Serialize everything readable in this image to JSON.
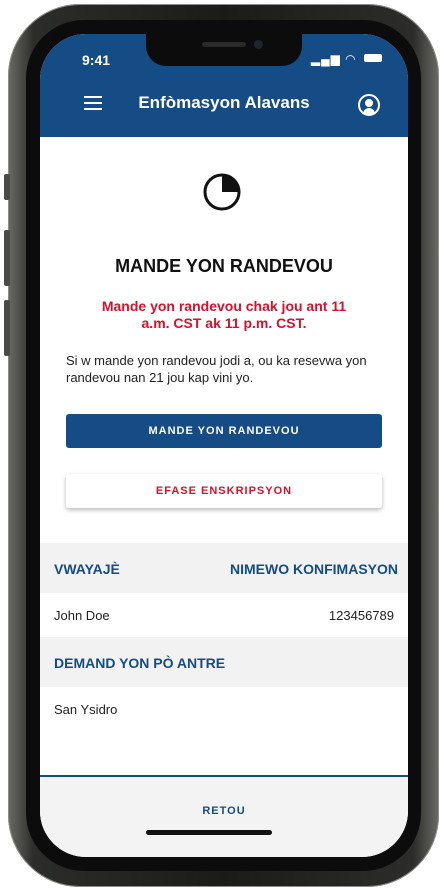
{
  "status_bar": {
    "time": "9:41",
    "signal_icon": "signal-icon",
    "wifi_icon": "wifi-icon",
    "battery_icon": "battery-icon"
  },
  "header": {
    "title": "Enfòmasyon Alavans",
    "menu_icon": "hamburger-menu-icon",
    "profile_icon": "user-profile-icon"
  },
  "main": {
    "icon": "clock-pie-icon",
    "title": "MANDE YON RANDEVOU",
    "notice": "Mande yon randevou chak jou ant 11 a.m. CST ak 11 p.m. CST.",
    "description": "Si w mande yon randevou jodi a, ou ka resevwa yon randevou nan 21 jou kap vini yo.",
    "request_button": "MANDE YON RANDEVOU",
    "delete_button": "EFASE ENSKRIPSYON"
  },
  "table": {
    "traveler_header": "VWAYAJÈ",
    "confirmation_header": "NIMEWO KONFIMASYON",
    "traveler_name": "John Doe",
    "confirmation_number": "123456789",
    "port_header": "DEMAND YON PÒ ANTRE",
    "port_value": "San Ysidro"
  },
  "footer": {
    "back_label": "RETOU"
  },
  "colors": {
    "primary": "#154c85",
    "accent_red": "#d7102c",
    "row_bg": "#f2f2f2"
  }
}
